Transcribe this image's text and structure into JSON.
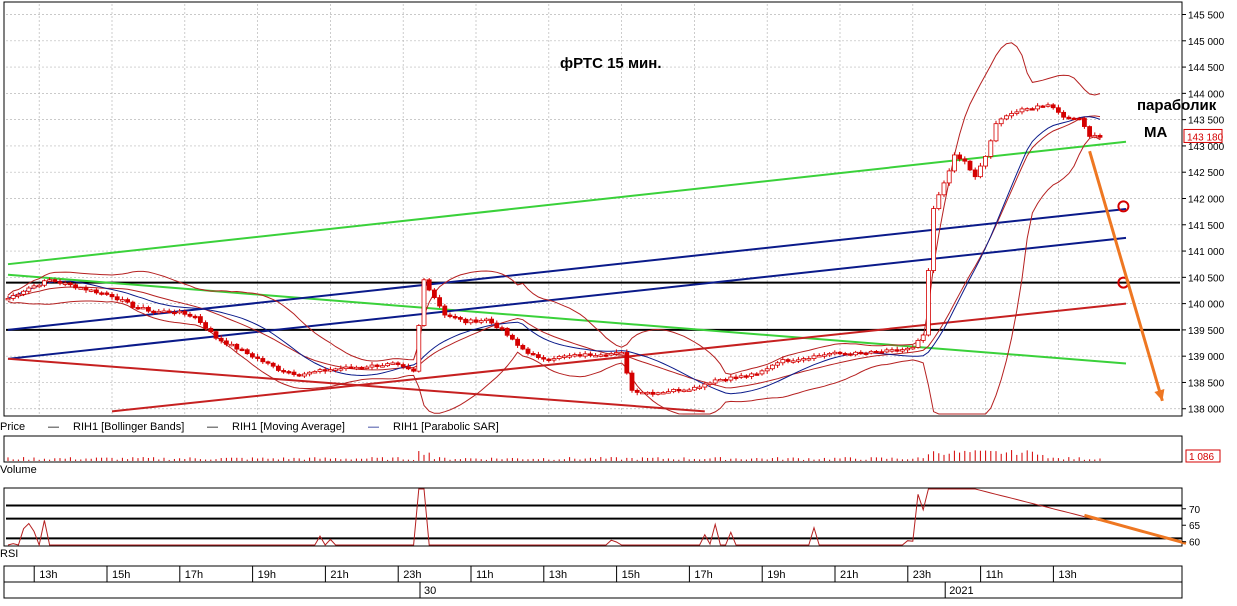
{
  "chart_data": {
    "type": "candlestick",
    "title": "фРТС  15 мин.",
    "y_axis": {
      "min": 137900,
      "max": 145700,
      "ticks": [
        138000,
        138500,
        139000,
        139500,
        140000,
        140500,
        141000,
        141500,
        142000,
        142500,
        143000,
        143500,
        144000,
        144500,
        145000,
        145500
      ],
      "tick_labels": [
        "138 000",
        "138 500",
        "139 000",
        "139 500",
        "140 000",
        "140 500",
        "141 000",
        "141 500",
        "142 000",
        "142 500",
        "143 000",
        "143 500",
        "144 000",
        "144 500",
        "145 000",
        "145 500"
      ],
      "last_price_label": "143 180",
      "last_price": 143180
    },
    "x_axis": {
      "time_labels": [
        "13h",
        "15h",
        "17h",
        "19h",
        "21h",
        "23h",
        "11h",
        "13h",
        "15h",
        "17h",
        "19h",
        "21h",
        "23h",
        "11h",
        "13h"
      ],
      "time_label_bars": [
        6,
        20,
        34,
        48,
        62,
        76,
        90,
        104,
        118,
        132,
        146,
        160,
        174,
        188,
        202
      ],
      "date_labels": [
        "30",
        "2021"
      ],
      "date_label_bars": [
        80,
        181
      ]
    },
    "annotations": [
      "параболик",
      "MA"
    ],
    "legend": [
      "Price",
      "RIH1 [Bollinger Bands]",
      "RIH1 [Moving Average]",
      "RIH1 [Parabolic SAR]"
    ],
    "volume": {
      "label": "Volume",
      "last_label": "1 086",
      "last": 1086
    },
    "rsi": {
      "label": "RSI",
      "ticks": [
        60,
        65,
        70
      ],
      "tick_labels": [
        "60",
        "65",
        "70"
      ],
      "levels": [
        61,
        67,
        71
      ]
    },
    "close_path": [
      [
        0,
        140100
      ],
      [
        4,
        140300
      ],
      [
        8,
        140450
      ],
      [
        12,
        140350
      ],
      [
        16,
        140250
      ],
      [
        20,
        140150
      ],
      [
        24,
        139950
      ],
      [
        28,
        139850
      ],
      [
        32,
        139850
      ],
      [
        36,
        139750
      ],
      [
        40,
        139350
      ],
      [
        44,
        139150
      ],
      [
        48,
        138950
      ],
      [
        52,
        138750
      ],
      [
        56,
        138650
      ],
      [
        62,
        138750
      ],
      [
        68,
        138800
      ],
      [
        74,
        138850
      ],
      [
        78,
        138700
      ],
      [
        80,
        140450
      ],
      [
        84,
        139800
      ],
      [
        88,
        139650
      ],
      [
        92,
        139700
      ],
      [
        95,
        139500
      ],
      [
        98,
        139200
      ],
      [
        102,
        138950
      ],
      [
        108,
        139000
      ],
      [
        114,
        139050
      ],
      [
        118,
        139050
      ],
      [
        120,
        138350
      ],
      [
        124,
        138300
      ],
      [
        128,
        138350
      ],
      [
        132,
        138400
      ],
      [
        136,
        138550
      ],
      [
        140,
        138600
      ],
      [
        144,
        138650
      ],
      [
        148,
        138900
      ],
      [
        152,
        138950
      ],
      [
        158,
        139050
      ],
      [
        164,
        139050
      ],
      [
        170,
        139100
      ],
      [
        174,
        139150
      ],
      [
        176,
        139400
      ],
      [
        178,
        141800
      ],
      [
        180,
        142300
      ],
      [
        182,
        142800
      ],
      [
        184,
        142700
      ],
      [
        186,
        142400
      ],
      [
        188,
        142800
      ],
      [
        190,
        143400
      ],
      [
        192,
        143600
      ],
      [
        196,
        143700
      ],
      [
        200,
        143800
      ],
      [
        204,
        143500
      ],
      [
        206,
        143550
      ],
      [
        208,
        143200
      ],
      [
        210,
        143180
      ]
    ],
    "lines": [
      {
        "name": "support-up-green",
        "color": "#3ad13a",
        "p1": [
          0,
          140750
        ],
        "p2": [
          215,
          143080
        ]
      },
      {
        "name": "down-green",
        "color": "#3ad13a",
        "p1": [
          0,
          140550
        ],
        "p2": [
          215,
          138860
        ]
      },
      {
        "name": "channel-blue-upper",
        "color": "#0a1a8a",
        "p1": [
          0,
          139500
        ],
        "p2": [
          215,
          141800
        ]
      },
      {
        "name": "channel-blue-lower",
        "color": "#0a1a8a",
        "p1": [
          0,
          138950
        ],
        "p2": [
          215,
          141250
        ]
      },
      {
        "name": "red-up",
        "color": "#c62020",
        "p1": [
          20,
          137950
        ],
        "p2": [
          215,
          140000
        ]
      },
      {
        "name": "red-down",
        "color": "#c62020",
        "p1": [
          0,
          138950
        ],
        "p2": [
          134,
          137950
        ]
      }
    ],
    "horizontal_levels": [
      140400,
      139500
    ],
    "forecast_arrow": {
      "color": "#ee7722",
      "from": [
        208,
        142900
      ],
      "to": [
        222,
        138150
      ]
    },
    "markers": [
      {
        "bar": 214.5,
        "value": 141850
      },
      {
        "bar": 214.5,
        "value": 140400
      }
    ],
    "colors": {
      "candle": "#d40000",
      "bollinger": "#b52020",
      "ma": "#b52020",
      "sar": "#0a1a8a",
      "grid": "#b8b8b8"
    }
  }
}
